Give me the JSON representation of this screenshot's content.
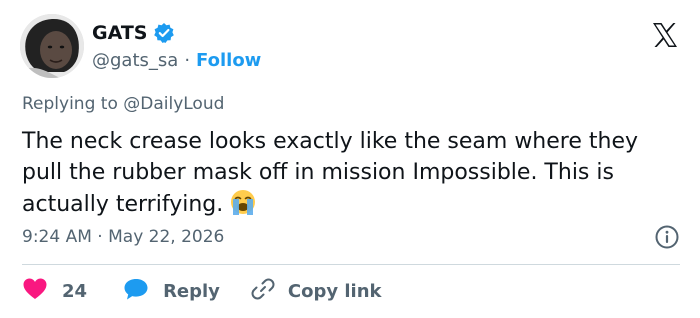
{
  "author": {
    "display_name": "GATS",
    "handle": "@gats_sa",
    "separator": "·",
    "follow_label": "Follow",
    "verified": true
  },
  "reply_context": {
    "prefix": "Replying to",
    "mention": "@DailyLoud"
  },
  "tweet": {
    "text": "The neck crease looks exactly like the seam where they pull the rubber mask off in mission Impossible. This is actually terrifying.",
    "emoji": "loudly-crying-face"
  },
  "meta": {
    "time": "9:24 AM",
    "separator": "·",
    "date": "May 22, 2026"
  },
  "actions": {
    "like_count": "24",
    "reply_label": "Reply",
    "copy_label": "Copy link"
  },
  "colors": {
    "accent": "#1d9bf0",
    "like": "#f91880",
    "text": "#0f1419",
    "secondary": "#536471",
    "divider": "#cfd9de"
  },
  "icons": [
    "verified-badge-icon",
    "x-logo-icon",
    "info-icon",
    "heart-icon",
    "reply-bubble-icon",
    "link-icon"
  ]
}
